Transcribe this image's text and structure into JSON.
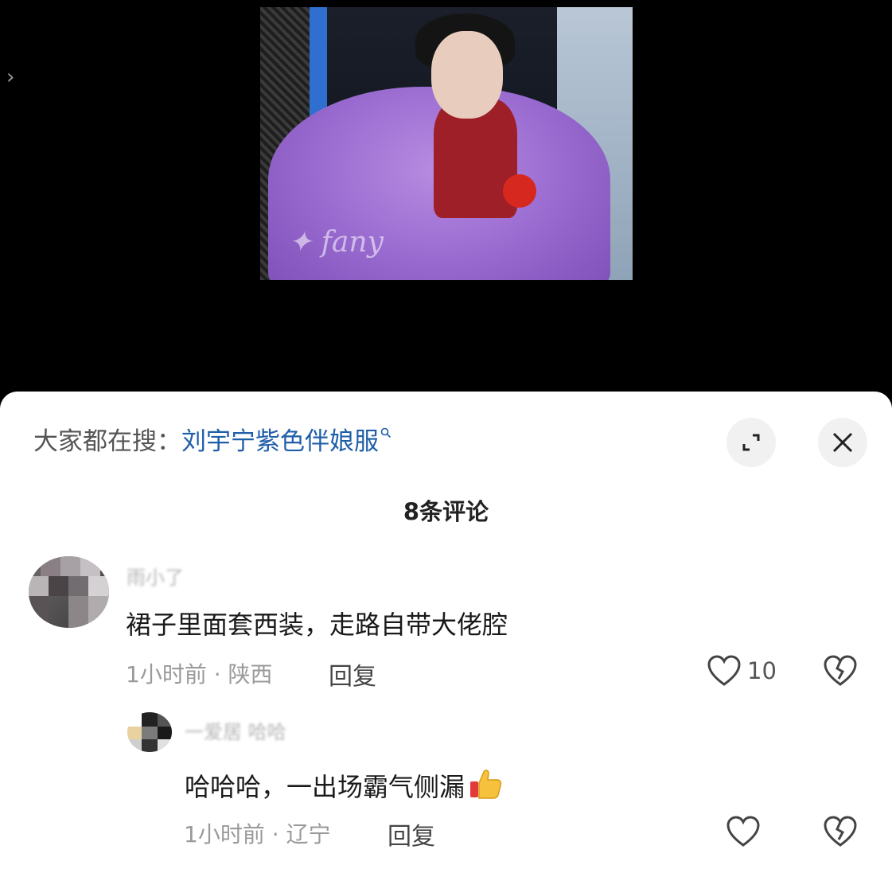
{
  "player": {
    "watermark": "✦ fany"
  },
  "search_bar": {
    "prefix": "大家都在搜：",
    "term": "刘宇宁紫色伴娘服"
  },
  "comments_header": {
    "count_label": "8条评论"
  },
  "comments": [
    {
      "username": "雨小了 ",
      "text": "裙子里面套西装，走路自带大佬腔",
      "meta": "1小时前 · 陕西",
      "reply_label": "回复",
      "like_count": "10"
    },
    {
      "username": "一爱居 哈哈",
      "text": "哈哈哈，一出场霸气侧漏",
      "meta": "1小时前 · 辽宁",
      "reply_label": "回复"
    }
  ],
  "colors": {
    "search_term": "#1f5fa8",
    "sheet_bg": "#ffffff",
    "page_bg": "#000000"
  },
  "icons": [
    "chevron-right-icon",
    "search-icon",
    "expand-icon",
    "close-icon",
    "heart-icon",
    "broken-heart-icon",
    "thumbs-up-emoji"
  ]
}
